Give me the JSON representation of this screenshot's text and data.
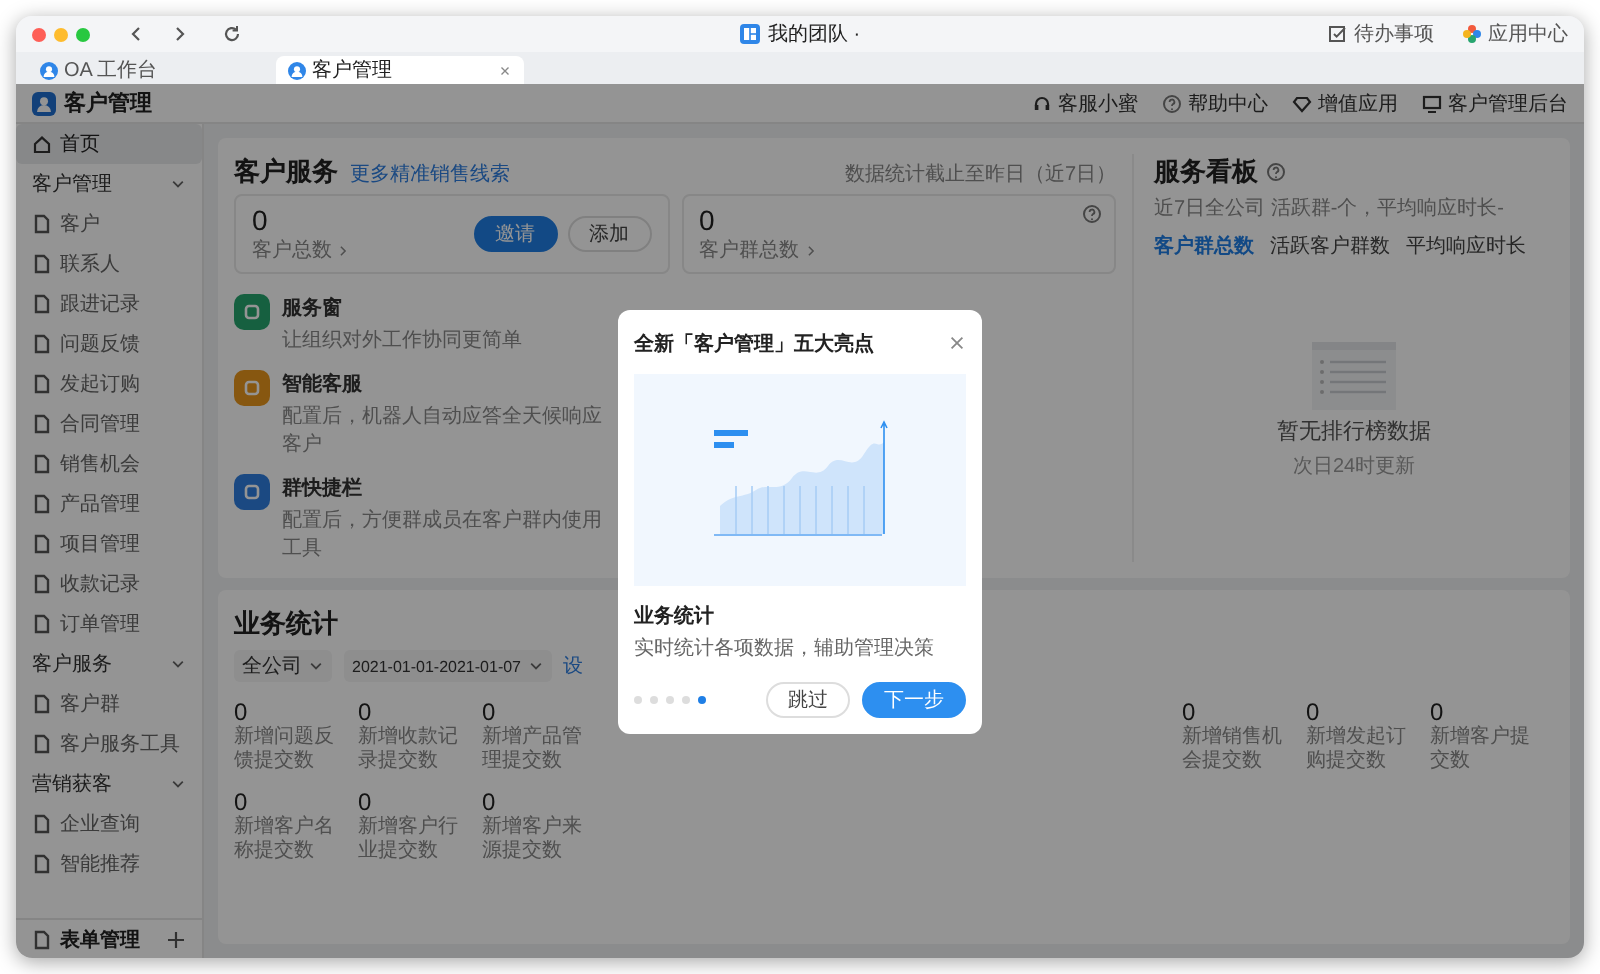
{
  "window": {
    "title": "我的团队 ·",
    "actions": [
      {
        "label": "待办事项"
      },
      {
        "label": "应用中心"
      }
    ]
  },
  "tabs": [
    {
      "label": "OA 工作台",
      "selected": false
    },
    {
      "label": "客户管理",
      "selected": true
    }
  ],
  "app": {
    "title": "客户管理",
    "links": [
      {
        "label": "客服小蜜"
      },
      {
        "label": "帮助中心"
      },
      {
        "label": "增值应用"
      },
      {
        "label": "客户管理后台"
      }
    ]
  },
  "sidebar": {
    "items": [
      {
        "kind": "link",
        "label": "首页",
        "selected": true
      },
      {
        "kind": "group",
        "label": "客户管理",
        "expanded": true,
        "children": [
          {
            "kind": "link",
            "label": "客户",
            "selected": false
          },
          {
            "kind": "link",
            "label": "联系人",
            "selected": false
          },
          {
            "kind": "link",
            "label": "跟进记录",
            "selected": false
          },
          {
            "kind": "link",
            "label": "问题反馈",
            "selected": false
          },
          {
            "kind": "link",
            "label": "发起订购",
            "selected": false
          },
          {
            "kind": "link",
            "label": "合同管理",
            "selected": false
          },
          {
            "kind": "link",
            "label": "销售机会",
            "selected": false
          },
          {
            "kind": "link",
            "label": "产品管理",
            "selected": false
          },
          {
            "kind": "link",
            "label": "项目管理",
            "selected": false
          },
          {
            "kind": "link",
            "label": "收款记录",
            "selected": false
          },
          {
            "kind": "link",
            "label": "订单管理",
            "selected": false
          }
        ]
      },
      {
        "kind": "group",
        "label": "客户服务",
        "expanded": true,
        "children": [
          {
            "kind": "link",
            "label": "客户群",
            "selected": false
          },
          {
            "kind": "link",
            "label": "客户服务工具",
            "selected": false
          }
        ]
      },
      {
        "kind": "group",
        "label": "营销获客",
        "expanded": true,
        "children": [
          {
            "kind": "link",
            "label": "企业查询",
            "selected": false
          },
          {
            "kind": "link",
            "label": "智能推荐",
            "selected": false
          }
        ]
      }
    ],
    "footer": {
      "label": "表单管理"
    }
  },
  "customer_service": {
    "title": "客户服务",
    "link": "更多精准销售线索",
    "note": "数据统计截止至昨日（近7日）",
    "cards": [
      {
        "value": "0",
        "label": "客户总数",
        "buttons": [
          {
            "label": "邀请",
            "primary": true
          },
          {
            "label": "添加",
            "primary": false
          }
        ]
      },
      {
        "value": "0",
        "label": "客户群总数"
      }
    ],
    "features": [
      {
        "title": "服务窗",
        "desc": "让组织对外工作协同更简单"
      },
      {
        "title": "智能客服",
        "desc": "配置后，机器人自动应答全天候响应客户"
      },
      {
        "title": "群快捷栏",
        "desc": "配置后，方便群成员在客户群内使用工具"
      }
    ]
  },
  "service_board": {
    "title": "服务看板",
    "subtitle": "近7日全公司 活跃群-个，平均响应时长-",
    "tabs": [
      {
        "label": "客户群总数",
        "selected": true
      },
      {
        "label": "活跃客户群数",
        "selected": false
      },
      {
        "label": "平均响应时长",
        "selected": false
      }
    ],
    "empty_title": "暂无排行榜数据",
    "empty_subtitle": "次日24时更新"
  },
  "business_stats": {
    "title": "业务统计",
    "filters": [
      {
        "value": "全公司"
      },
      {
        "value": "2021-01-01-2021-01-07"
      }
    ],
    "link": "设",
    "rows": [
      [
        {
          "value": "0",
          "label": "新增问题反馈提交数"
        },
        {
          "value": "0",
          "label": "新增收款记录提交数"
        },
        {
          "value": "0",
          "label": "新增产品管理提交数"
        },
        {
          "value": "0",
          "label": "新增销售机会提交数"
        },
        {
          "value": "0",
          "label": "新增发起订购提交数"
        },
        {
          "value": "0",
          "label": "新增客户提交数"
        }
      ],
      [
        {
          "value": "0",
          "label": "新增客户名称提交数"
        },
        {
          "value": "0",
          "label": "新增客户行业提交数"
        },
        {
          "value": "0",
          "label": "新增客户来源提交数"
        }
      ]
    ]
  },
  "dialog": {
    "title": "全新「客户管理」五大亮点",
    "feature_title": "业务统计",
    "feature_desc": "实时统计各项数据，辅助管理决策",
    "steps": [
      {
        "selected": false
      },
      {
        "selected": false
      },
      {
        "selected": false
      },
      {
        "selected": false
      },
      {
        "selected": true
      }
    ],
    "buttons": [
      {
        "label": "跳过",
        "primary": false
      },
      {
        "label": "下一步",
        "primary": true
      }
    ]
  }
}
